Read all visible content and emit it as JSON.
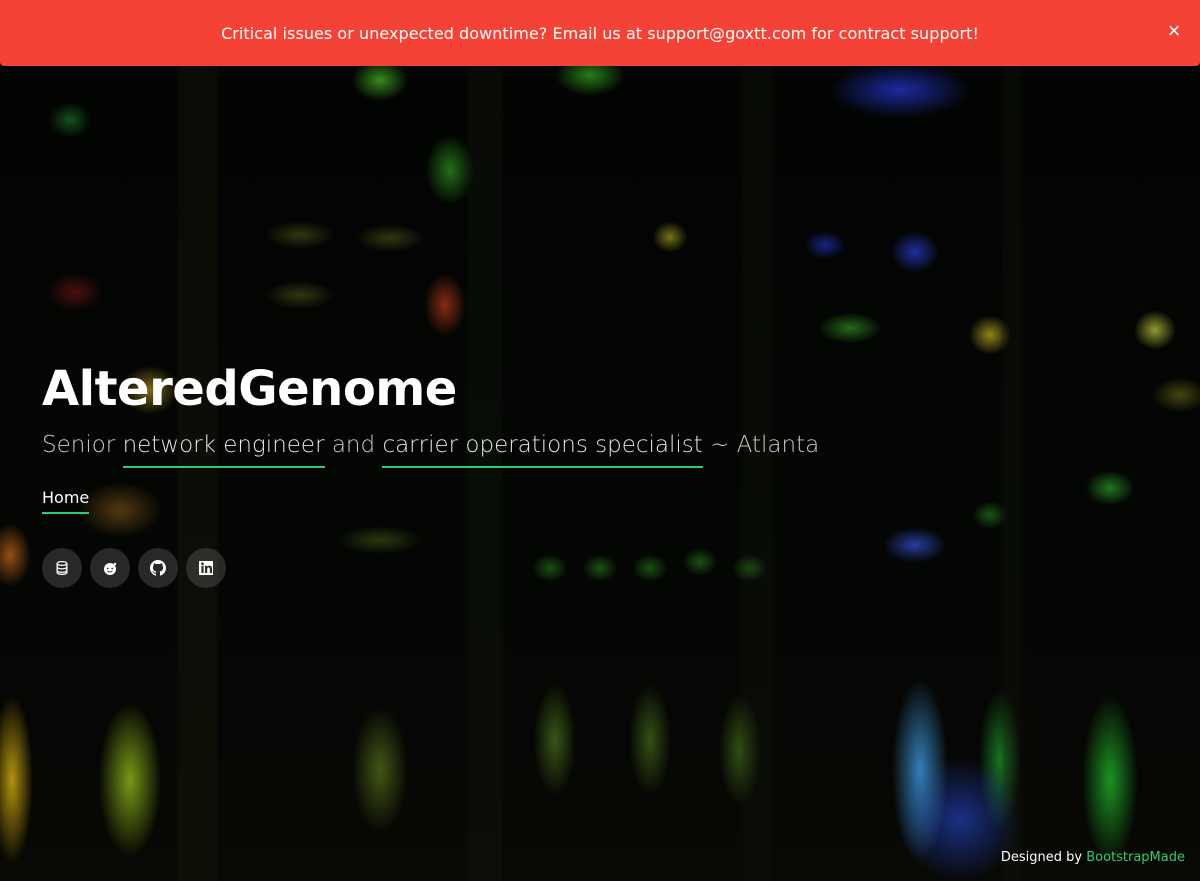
{
  "alert": {
    "message": "Critical issues or unexpected downtime? Email us at support@goxtt.com for contract support!",
    "close_label": "×"
  },
  "hero": {
    "title": "AlteredGenome",
    "subtitle": {
      "prefix": "Senior ",
      "highlight1": "network engineer",
      "middle": " and ",
      "highlight2": "carrier operations specialist",
      "suffix": " ~ Atlanta"
    }
  },
  "nav": {
    "items": [
      {
        "label": "Home"
      }
    ]
  },
  "social": {
    "items": [
      {
        "icon": "database-icon"
      },
      {
        "icon": "reddit-icon"
      },
      {
        "icon": "github-icon"
      },
      {
        "icon": "linkedin-icon"
      }
    ]
  },
  "credits": {
    "prefix": "Designed by ",
    "link_label": "BootstrapMade"
  },
  "colors": {
    "alert_bg": "#f44336",
    "accent": "#2ecc71",
    "text": "#ffffff"
  }
}
